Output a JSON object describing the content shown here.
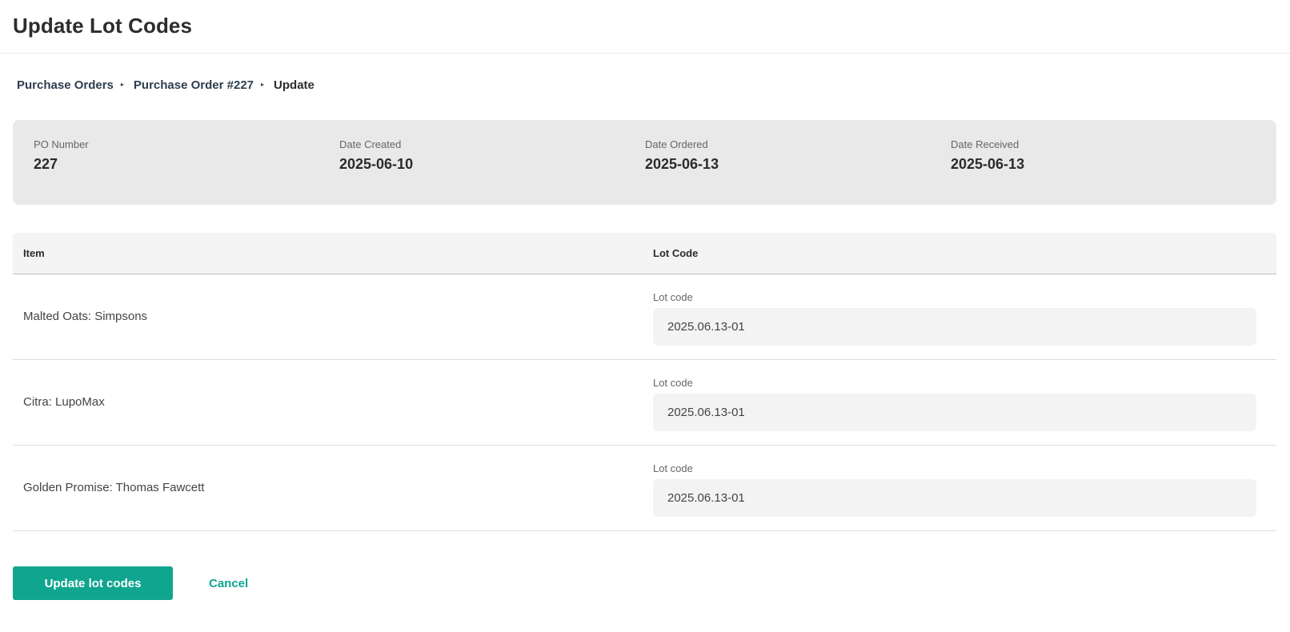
{
  "page": {
    "title": "Update Lot Codes"
  },
  "breadcrumb": {
    "items": [
      "Purchase Orders",
      "Purchase Order #227"
    ],
    "current": "Update",
    "separator": "▸"
  },
  "summary": {
    "fields": [
      {
        "label": "PO Number",
        "value": "227"
      },
      {
        "label": "Date Created",
        "value": "2025-06-10"
      },
      {
        "label": "Date Ordered",
        "value": "2025-06-13"
      },
      {
        "label": "Date Received",
        "value": "2025-06-13"
      }
    ]
  },
  "table": {
    "headers": {
      "item": "Item",
      "lot": "Lot Code"
    },
    "rows": [
      {
        "item": "Malted Oats: Simpsons",
        "lot_label": "Lot code",
        "lot_value": "2025.06.13-01"
      },
      {
        "item": "Citra: LupoMax",
        "lot_label": "Lot code",
        "lot_value": "2025.06.13-01"
      },
      {
        "item": "Golden Promise: Thomas Fawcett",
        "lot_label": "Lot code",
        "lot_value": "2025.06.13-01"
      }
    ]
  },
  "actions": {
    "submit_label": "Update lot codes",
    "cancel_label": "Cancel"
  },
  "colors": {
    "accent": "#10a58f",
    "summary_background": "#e9e9e9"
  }
}
